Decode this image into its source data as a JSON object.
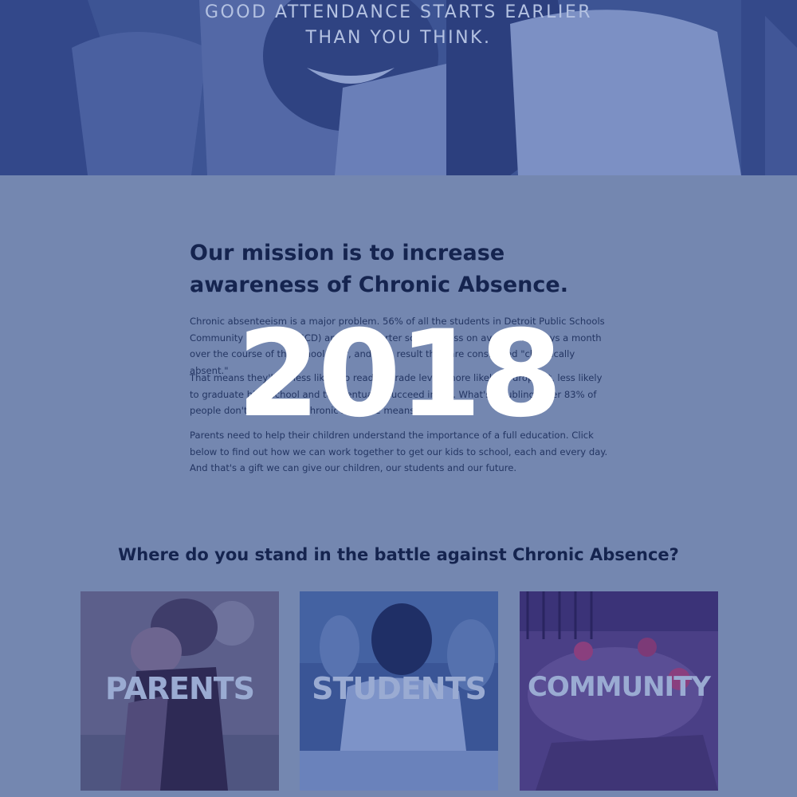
{
  "hero": {
    "line1": "GOOD ATTENDANCE STARTS EARLIER",
    "line2": "THAN YOU THINK."
  },
  "mission": {
    "title_line1": "Our mission is to increase",
    "title_line2": "awareness of Chronic Absence.",
    "paragraph1": "Chronic absenteeism is a major problem. 56% of all the students in Detroit Public Schools Community District (DPSCD) and area charter schools miss on average 2+ days a month over the course of the school year, and as a result they are considered \"chronically absent.\"",
    "paragraph2": "That means they'll be less likely to read at grade level, more likely to drop out, less likely to graduate high school and to eventually succeed in life. What's troubling, over 83% of people don't know what Chronic Absence means.",
    "paragraph3": "Parents need to help their children understand the importance of a full education. Click below to find out how we can work together to get our kids to school, each and every day. And that's a gift we can give our children, our students and our future."
  },
  "watermark": "2018",
  "stand": {
    "title": "Where do you stand in the battle against Chronic Absence?"
  },
  "cards": [
    {
      "label": "PARENTS"
    },
    {
      "label": "STUDENTS"
    },
    {
      "label": "COMMUNITY"
    }
  ],
  "colors": {
    "page_background": "#7487b0",
    "hero_overlay": "#3d5494",
    "heading": "#15244f",
    "watermark": "#ffffff"
  }
}
